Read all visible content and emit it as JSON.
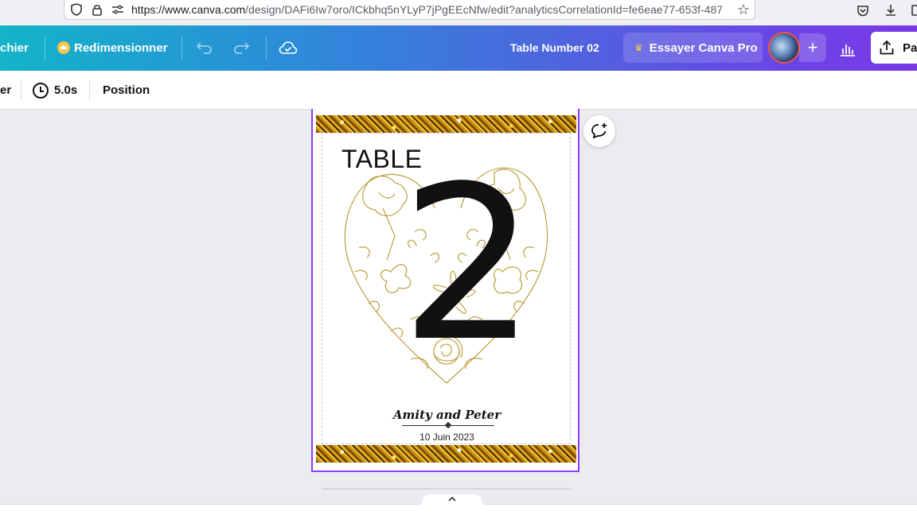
{
  "browser": {
    "url_host": "https://www.canva.com",
    "url_rest": "/design/DAFi6Iw7oro/ICkbhq5nYLyP7jPgEEcNfw/edit?analyticsCorrelationId=fe6eae77-653f-4871-"
  },
  "header": {
    "file_menu": "chier",
    "resize": "Redimensionner",
    "design_title": "Table Number 02",
    "try_pro": "Essayer Canva Pro",
    "share": "Pa"
  },
  "toolbar": {
    "left_fragment": "er",
    "duration": "5.0s",
    "position": "Position"
  },
  "design": {
    "table_label": "TABLE",
    "number": "2",
    "names": "Amity and Peter",
    "date": "10 Juin 2023"
  },
  "colors": {
    "selection": "#8b3dff",
    "gold": "#c9900f",
    "floral_line": "#b8962e"
  }
}
